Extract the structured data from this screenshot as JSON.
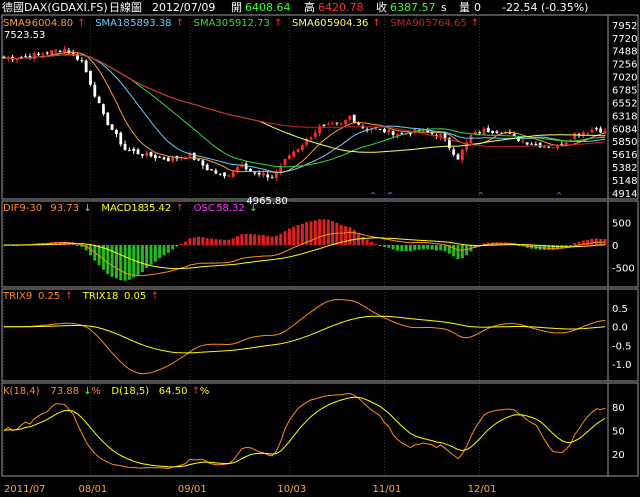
{
  "header": {
    "title": "德國DAX(GDAXI.FS)",
    "period": "日線圖",
    "date": "2012/07/09",
    "open_label": "開",
    "open": "6408.64",
    "high_label": "高",
    "high": "6420.78",
    "close_label": "收",
    "close": "6387.57",
    "close_suffix": "s",
    "volume_label": "量",
    "volume": "0",
    "change": "-22.54 (-0.35%)"
  },
  "colors": {
    "background": "#000000",
    "grid": "#5a5a5a",
    "axis_text": "#ffffff",
    "up": "#ff2a2a",
    "down": "#ffffff",
    "sma9": "#ff9933",
    "sma18": "#66ccff",
    "sma30": "#33dd33",
    "sma60": "#ffff66",
    "sma90": "#cc2222",
    "macd_line": "#ffff00",
    "dif_line": "#ff8c1a",
    "osc_up": "#dd2222",
    "osc_down": "#22bb22",
    "osc_label": "#ff33ff",
    "date_text": "#ffaa33"
  },
  "chart_data": [
    {
      "type": "candlestick",
      "panel": "price",
      "legend": [
        {
          "label": "SMA9",
          "value": "6004.80",
          "arrow": "↑",
          "color_key": "sma9"
        },
        {
          "label": "SMA18",
          "value": "5893.38",
          "arrow": "↑",
          "color_key": "sma18"
        },
        {
          "label": "SMA30",
          "value": "5912.73",
          "arrow": "↑",
          "color_key": "sma30"
        },
        {
          "label": "SMA60",
          "value": "5904.36",
          "arrow": "↑",
          "color_key": "sma60"
        },
        {
          "label": "SMA90",
          "value": "5764.65",
          "arrow": "↑",
          "color_key": "sma90"
        }
      ],
      "y_ticks": [
        "7952",
        "7720",
        "7488",
        "7256",
        "7020",
        "6785",
        "6552",
        "6318",
        "6084",
        "5850",
        "5616",
        "5382",
        "5148",
        "4914"
      ],
      "ylim": [
        4914,
        7952
      ],
      "annotations": [
        {
          "text": "7523.53",
          "value": 7523.53,
          "type": "high"
        },
        {
          "text": "4965.80",
          "value": 4965.8,
          "type": "low"
        }
      ],
      "x_ticks": [
        "2011/07",
        "08/01",
        "09/01",
        "10/03",
        "11/01",
        "12/01"
      ],
      "x_tick_index": [
        0,
        20,
        43,
        66,
        88,
        110
      ],
      "n_bars": 140,
      "waypoints": [
        [
          0,
          7350
        ],
        [
          6,
          7390
        ],
        [
          14,
          7520
        ],
        [
          18,
          7300
        ],
        [
          23,
          6300
        ],
        [
          28,
          5700
        ],
        [
          33,
          5600
        ],
        [
          38,
          5520
        ],
        [
          43,
          5600
        ],
        [
          47,
          5350
        ],
        [
          51,
          5200
        ],
        [
          55,
          5450
        ],
        [
          58,
          5250
        ],
        [
          62,
          5200
        ],
        [
          66,
          5600
        ],
        [
          69,
          5800
        ],
        [
          73,
          6100
        ],
        [
          78,
          6150
        ],
        [
          80,
          6300
        ],
        [
          83,
          6100
        ],
        [
          87,
          6050
        ],
        [
          92,
          5980
        ],
        [
          96,
          6050
        ],
        [
          101,
          5950
        ],
        [
          105,
          5550
        ],
        [
          108,
          5950
        ],
        [
          111,
          6050
        ],
        [
          115,
          6030
        ],
        [
          120,
          5850
        ],
        [
          124,
          5780
        ],
        [
          128,
          5750
        ],
        [
          132,
          5980
        ],
        [
          137,
          6080
        ],
        [
          139,
          6020
        ]
      ]
    },
    {
      "type": "bar",
      "panel": "macd",
      "legend": [
        {
          "label": "DIF9-30",
          "value": "93.73",
          "arrow": "↓",
          "color_key": "dif_line"
        },
        {
          "label": "MACD18",
          "value": "35.42",
          "arrow": "↑",
          "color_key": "macd_line"
        },
        {
          "label": "OSC",
          "value": "58.32",
          "arrow": "↓",
          "color_key": "osc_label"
        }
      ],
      "y_ticks": [
        "500",
        "0",
        "-500"
      ],
      "ylim": [
        -800,
        800
      ]
    },
    {
      "type": "line",
      "panel": "trix",
      "legend": [
        {
          "label": "TRIX9",
          "value": "0.25",
          "arrow": "↑",
          "color_key": "dif_line"
        },
        {
          "label": "TRIX18",
          "value": "0.05",
          "arrow": "↑",
          "color_key": "macd_line"
        }
      ],
      "y_ticks": [
        "0.5",
        "0.0",
        "-0.5",
        "-1.0"
      ],
      "ylim": [
        -1.3,
        0.8
      ]
    },
    {
      "type": "line",
      "panel": "kd",
      "legend": [
        {
          "label": "K(18,4)",
          "value": "73.88",
          "arrow": "↓",
          "suffix": "%",
          "color_key": "dif_line"
        },
        {
          "label": "D(18,5)",
          "value": "64.50",
          "arrow": "↑",
          "suffix": "%",
          "color_key": "macd_line"
        }
      ],
      "y_ticks": [
        "80",
        "50",
        "20"
      ],
      "ylim": [
        0,
        100
      ]
    }
  ]
}
